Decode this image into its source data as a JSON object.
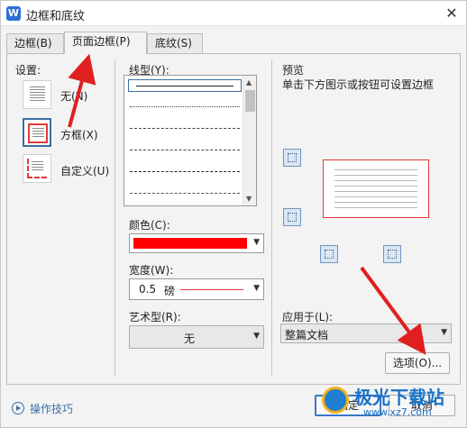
{
  "window": {
    "title": "边框和底纹",
    "app_icon": "W"
  },
  "tabs": [
    {
      "label": "边框(B)"
    },
    {
      "label": "页面边框(P)"
    },
    {
      "label": "底纹(S)"
    }
  ],
  "settings": {
    "heading": "设置:",
    "items": [
      {
        "label": "无(N)",
        "icon": "no-border-icon"
      },
      {
        "label": "方框(X)",
        "icon": "box-border-icon"
      },
      {
        "label": "自定义(U)",
        "icon": "custom-border-icon"
      }
    ]
  },
  "line_style": {
    "heading": "线型(Y):"
  },
  "color": {
    "heading": "颜色(C):",
    "value_color": "#ff0000"
  },
  "width": {
    "heading": "宽度(W):",
    "value": "0.5",
    "unit": "磅",
    "line_color": "#e53935"
  },
  "art": {
    "heading": "艺术型(R):",
    "value": "无"
  },
  "preview": {
    "heading": "预览",
    "hint": "单击下方图示或按钮可设置边框"
  },
  "apply_to": {
    "heading": "应用于(L):",
    "value": "整篇文档"
  },
  "buttons": {
    "options": "选项(O)...",
    "ok": "确定",
    "cancel": "取消"
  },
  "footer": {
    "tips": "操作技巧"
  },
  "watermark": {
    "title": "极光下载站",
    "url": "www.xz7.com"
  },
  "colors": {
    "accent": "#3a6ea5",
    "border_red": "#e53935"
  }
}
